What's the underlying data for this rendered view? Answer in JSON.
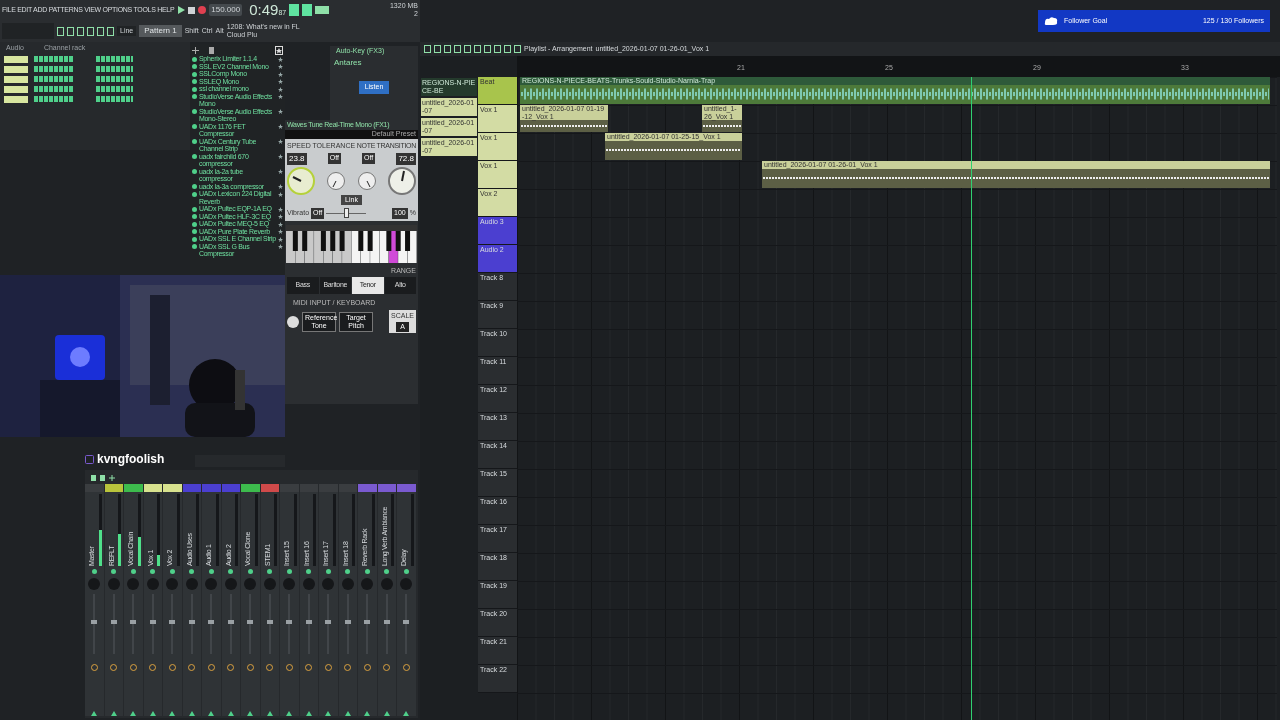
{
  "top_bar": {
    "menu": "FILE EDIT ADD PATTERNS VIEW OPTIONS TOOLS HELP",
    "tempo": "150.000",
    "time": "0:49",
    "time_fraction": "87",
    "pattern": "Pattern 1",
    "snap": "Line",
    "modifiers": [
      "Shift",
      "Ctrl",
      "Alt"
    ],
    "news": "1208: What's new in FL Cloud Plu",
    "memory": "1320 MB",
    "cpu": "2"
  },
  "channel_rack": {
    "filter": "Audio",
    "title": "Channel rack"
  },
  "browser": {
    "items": [
      "Spherix Limiter 1.1.4",
      "SSL EV2 Channel Mono",
      "SSLComp Mono",
      "SSLEQ Mono",
      "ssl channel mono",
      "StudioVerse Audio Effects Mono",
      "StudioVerse Audio Effects Mono-Stereo",
      "UADx 1176 FET Compressor",
      "UADx Century Tube Channel Strip",
      "uadx fairchild 670 compressor",
      "uadx la-2a tube compressor",
      "uadx la-3a compressor",
      "UADx Lexicon 224 Digital Reverb",
      "UADx Pultec EQP-1A EQ",
      "UADx Pultec HLF-3C EQ",
      "UADx Pultec MEQ-5 EQ",
      "UADx Pure Plate Reverb",
      "UADx SSL E Channel Strip",
      "UADx SSL G Bus Compressor"
    ]
  },
  "auto_key": {
    "title": "Auto-Key (FX3)",
    "brand": "Antares",
    "button": "Listen"
  },
  "waves_tune": {
    "title": "Waves Tune Real-Time Mono (FX1)",
    "preset": "Default Preset",
    "speed_label": "SPEED",
    "speed": "23.8",
    "tolerance_label": "TOLERANCE",
    "tolerance": [
      "Off",
      "Off"
    ],
    "transition_label": "NOTE TRANSITION",
    "transition": "72.8",
    "link": "Link",
    "vibrato_label": "Vibrato",
    "vibrato": "Off",
    "vibrato_slider": {
      "level": 0.5
    },
    "amount": "100",
    "unit": "%",
    "range_label": "RANGE",
    "ranges": [
      {
        "label": "Bass",
        "selected": false
      },
      {
        "label": "Baritone",
        "selected": false
      },
      {
        "label": "Tenor",
        "selected": true
      },
      {
        "label": "Alto",
        "selected": false
      }
    ],
    "midi_label": "MIDI INPUT / KEYBOARD",
    "buttons": [
      "Reference Tone",
      "Target Pitch"
    ],
    "scale_label": "SCALE",
    "scale": "A"
  },
  "streamer": "kvngfoolish",
  "mixer": {
    "strips": [
      {
        "name": "Master",
        "color": "#3a3d40",
        "level": 0.5
      },
      {
        "name": "REFLT",
        "color": "#b9c43c",
        "level": 0.45
      },
      {
        "name": "Vocal Chain",
        "color": "#3dbb4d",
        "level": 0.4
      },
      {
        "name": "Vox 1",
        "color": "#d8e28e",
        "level": 0.15
      },
      {
        "name": "Vox 2",
        "color": "#d8e28e",
        "level": 0
      },
      {
        "name": "Audio Uses",
        "color": "#4b3fd0",
        "level": 0
      },
      {
        "name": "Audio 1",
        "color": "#4b3fd0",
        "level": 0
      },
      {
        "name": "Audio 2",
        "color": "#4b3fd0",
        "level": 0
      },
      {
        "name": "Vocal Clone",
        "color": "#3dbb4d",
        "level": 0
      },
      {
        "name": "STEM1",
        "color": "#d04a4a",
        "level": 0
      },
      {
        "name": "Insert 15",
        "color": "#3a3d40",
        "level": 0
      },
      {
        "name": "Insert 16",
        "color": "#3a3d40",
        "level": 0
      },
      {
        "name": "Insert 17",
        "color": "#3a3d40",
        "level": 0
      },
      {
        "name": "Insert 18",
        "color": "#3a3d40",
        "level": 0
      },
      {
        "name": "Reverb Rack",
        "color": "#7a5ad0",
        "level": 0
      },
      {
        "name": "Long Verb Ambiance",
        "color": "#7a5ad0",
        "level": 0
      },
      {
        "name": "Delay",
        "color": "#7a5ad0",
        "level": 0
      }
    ]
  },
  "playlist": {
    "title": "Playlist - Arrangement",
    "path": "untitled_2026-01-07 01-26-01_Vox 1",
    "ruler": [
      "21",
      "25",
      "29",
      "33"
    ],
    "picker": [
      "REGIONS-N-PIECE-BE",
      "untitled_2026-01-07",
      "untitled_2026-01-07",
      "untitled_2026-01-07"
    ],
    "tracks": [
      {
        "name": "Beat",
        "color": "#a8c44c"
      },
      {
        "name": "Vox 1",
        "color": "#d3dca4"
      },
      {
        "name": "Vox 1",
        "color": "#d3dca4"
      },
      {
        "name": "Vox 1",
        "color": "#d3dca4"
      },
      {
        "name": "Vox 2",
        "color": "#d3dca4"
      },
      {
        "name": "Audio 3",
        "color": "#4b3fd0"
      },
      {
        "name": "Audio 2",
        "color": "#4b3fd0"
      },
      {
        "name": "Track 8",
        "color": "#2a2d30"
      },
      {
        "name": "Track 9",
        "color": "#2a2d30"
      },
      {
        "name": "Track 10",
        "color": "#2a2d30"
      },
      {
        "name": "Track 11",
        "color": "#2a2d30"
      },
      {
        "name": "Track 12",
        "color": "#2a2d30"
      },
      {
        "name": "Track 13",
        "color": "#2a2d30"
      },
      {
        "name": "Track 14",
        "color": "#2a2d30"
      },
      {
        "name": "Track 15",
        "color": "#2a2d30"
      },
      {
        "name": "Track 16",
        "color": "#2a2d30"
      },
      {
        "name": "Track 17",
        "color": "#2a2d30"
      },
      {
        "name": "Track 18",
        "color": "#2a2d30"
      },
      {
        "name": "Track 19",
        "color": "#2a2d30"
      },
      {
        "name": "Track 20",
        "color": "#2a2d30"
      },
      {
        "name": "Track 21",
        "color": "#2a2d30"
      },
      {
        "name": "Track 22",
        "color": "#2a2d30"
      }
    ],
    "clips": [
      {
        "kind": "beat",
        "name": "REGIONS-N-PIECE-BEATS-Trunks-Sould-Studio-Narnia-Trap"
      },
      {
        "kind": "vocal",
        "name": "untitled_2026-01-07 01-19-12_Vox 1"
      },
      {
        "kind": "vocal",
        "name": "untitled_1-26_Vox 1"
      },
      {
        "kind": "vocal",
        "name": "untitled_2026-01-07 01-25-15_Vox 1"
      },
      {
        "kind": "vocal",
        "name": "untitled_2026-01-07 01-26-01_Vox 1"
      }
    ]
  },
  "follower_goal": {
    "label": "Follower Goal",
    "count": "125 / 130 Followers"
  }
}
